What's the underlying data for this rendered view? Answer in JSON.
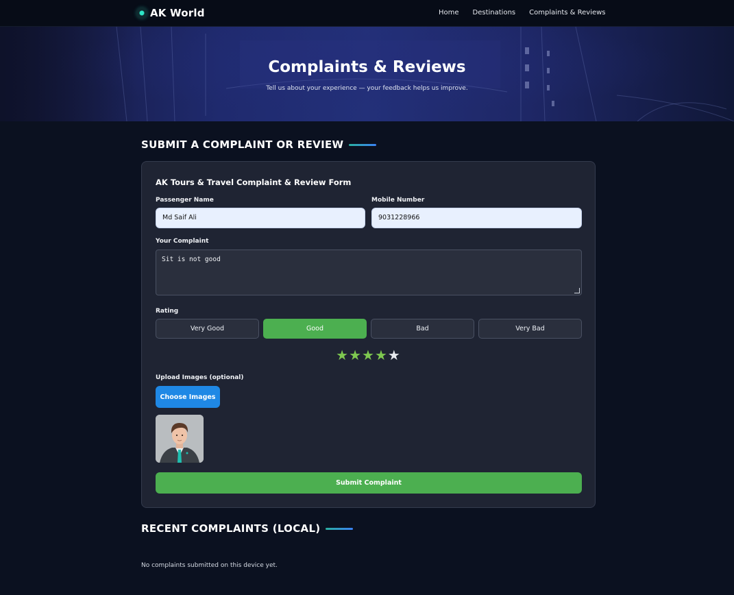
{
  "nav": {
    "brand": "AK World",
    "links": [
      "Home",
      "Destinations",
      "Complaints & Reviews"
    ]
  },
  "hero": {
    "title": "Complaints & Reviews",
    "subtitle": "Tell us about your experience — your feedback helps us improve."
  },
  "form_section": {
    "heading": "SUBMIT A COMPLAINT OR REVIEW",
    "form_title": "AK Tours & Travel Complaint & Review Form",
    "passenger_name": {
      "label": "Passenger Name",
      "value": "Md Saif Ali"
    },
    "mobile": {
      "label": "Mobile Number",
      "value": "9031228966"
    },
    "complaint": {
      "label": "Your Complaint",
      "value": "Sit is not good"
    },
    "rating": {
      "label": "Rating",
      "options": [
        "Very Good",
        "Good",
        "Bad",
        "Very Bad"
      ],
      "selected": "Good",
      "stars_filled": 4,
      "stars_total": 5
    },
    "upload": {
      "label": "Upload Images (optional)",
      "button": "Choose Images"
    },
    "submit": "Submit Complaint"
  },
  "recent_section": {
    "heading": "RECENT COMPLAINTS (LOCAL)",
    "empty_text": "No complaints submitted on this device yet."
  },
  "colors": {
    "background": "#0b1120",
    "card": "#1f2433",
    "accent_green": "#4caf50",
    "accent_blue": "#1f88e5",
    "star_filled": "#7ec850"
  }
}
